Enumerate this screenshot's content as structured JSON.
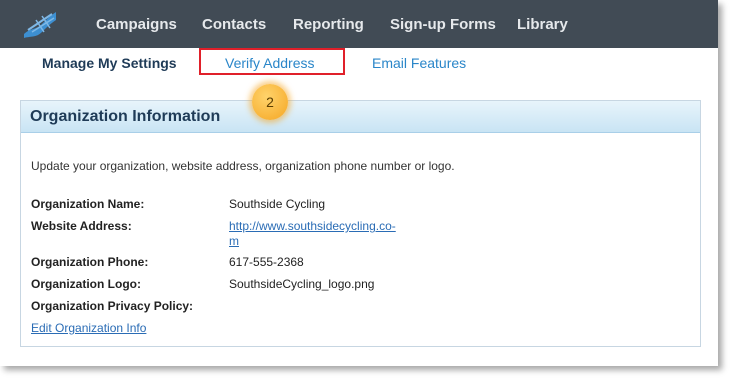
{
  "nav": {
    "logo_icon": "flag-logo-icon",
    "items": [
      "Campaigns",
      "Contacts",
      "Reporting",
      "Sign-up Forms",
      "Library"
    ]
  },
  "subnav": {
    "items": [
      "Manage My Settings",
      "Verify Address",
      "Email Features"
    ]
  },
  "callout": {
    "number": "2"
  },
  "panel": {
    "title": "Organization Information",
    "description": "Update your organization, website address, organization phone number or logo.",
    "fields": {
      "name_label": "Organization Name:",
      "name_value": "Southside Cycling",
      "website_label": "Website Address:",
      "website_value_line1": "http://www.southsidecycling.co-",
      "website_value_line2": "m",
      "phone_label": "Organization Phone:",
      "phone_value": "617-555-2368",
      "logo_label": "Organization Logo:",
      "logo_value": "SouthsideCycling_logo.png",
      "privacy_label": "Organization Privacy Policy:"
    },
    "edit_link": "Edit Organization Info"
  },
  "colors": {
    "nav_bg": "#414b55",
    "accent_link": "#2a86c9",
    "highlight": "#e0202a",
    "callout": "#f5a623"
  }
}
